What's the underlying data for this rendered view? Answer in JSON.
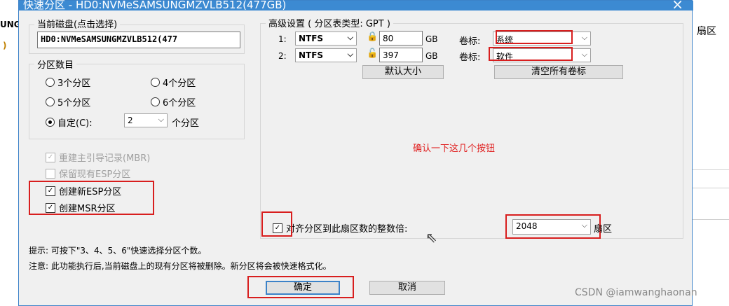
{
  "background": {
    "left_fragments": [
      "UNG",
      ")"
    ],
    "right_fragment": "扇区",
    "watermark": "CSDN @iamwanghaonan"
  },
  "dialog": {
    "title": "快速分区 - HD0:NVMeSAMSUNGMZVLB512(477GB)",
    "close_icon": "×",
    "current_disk": {
      "label": "当前磁盘(点击选择)",
      "value": "HD0:NVMeSAMSUNGMZVLB512(477"
    },
    "partition_count": {
      "label": "分区数目",
      "options": [
        "3个分区",
        "4个分区",
        "5个分区",
        "6个分区"
      ],
      "custom_label": "自定(C):",
      "custom_value": "2",
      "custom_suffix": "个分区"
    },
    "checks": {
      "rebuild_mbr": "重建主引导记录(MBR)",
      "keep_esp": "保留现有ESP分区",
      "create_esp": "创建新ESP分区",
      "create_msr": "创建MSR分区"
    },
    "advanced": {
      "label": "高级设置 ( 分区表类型: GPT )",
      "rows": [
        {
          "index": "1:",
          "fs": "NTFS",
          "size": "80",
          "unit": "GB",
          "vol_label": "卷标:",
          "vol_value": "系统"
        },
        {
          "index": "2:",
          "fs": "NTFS",
          "size": "397",
          "unit": "GB",
          "vol_label": "卷标:",
          "vol_value": "软件"
        }
      ],
      "default_size_btn": "默认大小",
      "clear_labels_btn": "清空所有卷标"
    },
    "annotation": "确认一下这几个按钮",
    "align": {
      "label": "对齐分区到此扇区数的整数倍:",
      "value": "2048",
      "suffix": "扇区"
    },
    "hint": "提示: 可按下\"3、4、5、6\"快速选择分区个数。",
    "warning": "注意: 此功能执行后,当前磁盘上的现有分区将被删除。新分区将会被快速格式化。",
    "ok_btn": "确定",
    "cancel_btn": "取消"
  },
  "colors": {
    "annotation_red": "#d81e1e",
    "title_blue": "#3c8ad2"
  }
}
